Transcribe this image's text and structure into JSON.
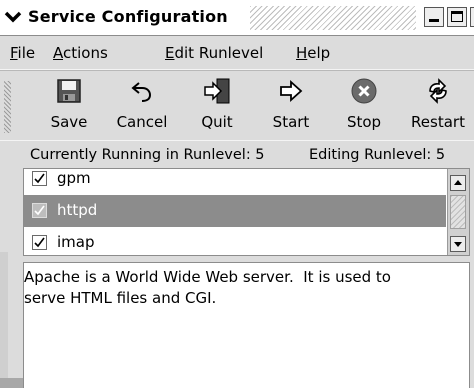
{
  "window": {
    "title": "Service Configuration",
    "controls": {
      "minimize": "minimize",
      "maximize": "maximize",
      "close": "×"
    }
  },
  "menubar": {
    "items": [
      {
        "label_ul": "F",
        "label_rest": "ile"
      },
      {
        "label_ul": "A",
        "label_rest": "ctions"
      },
      {
        "label_ul": "E",
        "label_rest": "dit Runlevel"
      },
      {
        "label_ul": "H",
        "label_rest": "elp"
      }
    ]
  },
  "toolbar": {
    "buttons": [
      {
        "label": "Save",
        "icon": "save-icon"
      },
      {
        "label": "Cancel",
        "icon": "undo-icon"
      },
      {
        "label": "Quit",
        "icon": "exit-door-icon"
      },
      {
        "label": "Start",
        "icon": "arrow-right-icon"
      },
      {
        "label": "Stop",
        "icon": "stop-circle-icon"
      },
      {
        "label": "Restart",
        "icon": "restart-icon"
      }
    ]
  },
  "status": {
    "running": "Currently Running in Runlevel: 5",
    "editing": "Editing Runlevel: 5"
  },
  "services": [
    {
      "name": "gpm",
      "checked": true,
      "selected": false
    },
    {
      "name": "httpd",
      "checked": true,
      "selected": true
    },
    {
      "name": "imap",
      "checked": true,
      "selected": false
    }
  ],
  "description": {
    "text": "Apache is a World Wide Web server.  It is used to\nserve HTML files and CGI."
  },
  "colors": {
    "selection": "#8c8c8c",
    "stop_icon": "#6b6b6b",
    "window_bg": "#dcdcdc"
  }
}
